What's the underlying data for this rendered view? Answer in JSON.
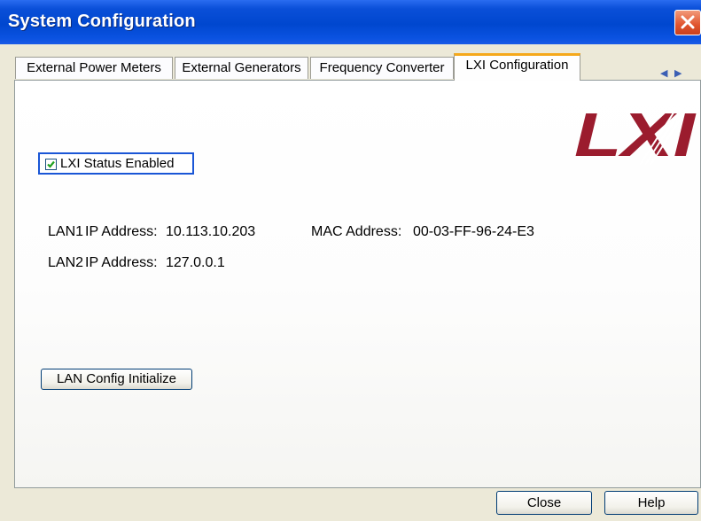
{
  "window": {
    "title": "System Configuration"
  },
  "tabs": [
    {
      "label": "External Power Meters"
    },
    {
      "label": "External Generators"
    },
    {
      "label": "Frequency Converter"
    },
    {
      "label": "LXI Configuration"
    }
  ],
  "tab_scroll": {
    "left": "◀",
    "right": "▶"
  },
  "logo": {
    "text": "LXI"
  },
  "lxi": {
    "status_checkbox": {
      "label": "LXI Status Enabled",
      "checked": true
    },
    "lan1": {
      "name": "LAN1",
      "ip_label": "IP Address:",
      "ip": "10.113.10.203",
      "mac_label": "MAC Address:",
      "mac": "00-03-FF-96-24-E3"
    },
    "lan2": {
      "name": "LAN2",
      "ip_label": "IP Address:",
      "ip": "127.0.0.1"
    },
    "init_button": "LAN Config Initialize"
  },
  "footer": {
    "close_label": "Close",
    "help_label": "Help"
  },
  "colors": {
    "title_bar": "#0047cf",
    "logo_red": "#9b1c2e",
    "active_tab_accent": "#f5a81a"
  }
}
